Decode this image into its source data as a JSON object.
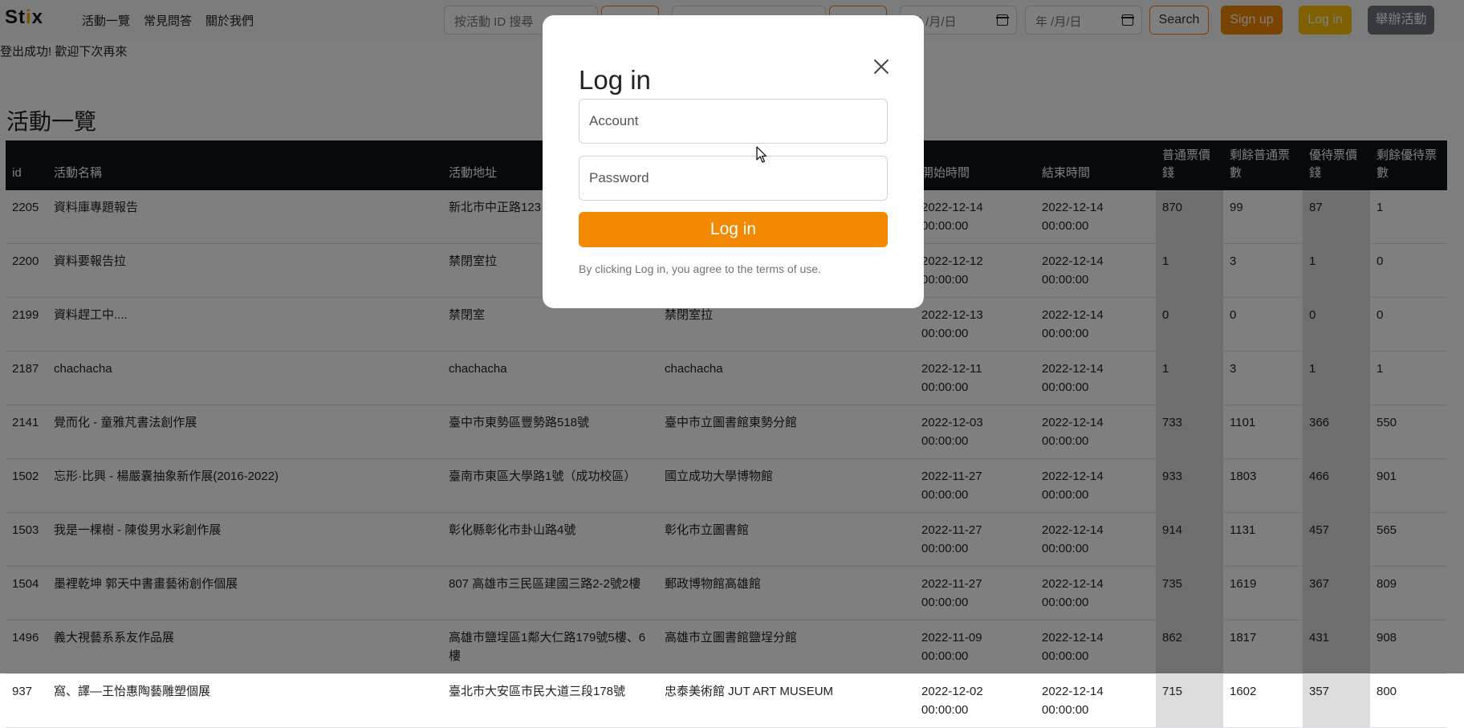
{
  "navbar": {
    "brand_prefix": "St",
    "brand_accent": "i",
    "brand_suffix": "x",
    "links": [
      "活動一覽",
      "常見問答",
      "關於我們"
    ],
    "search_id_placeholder": "按活動 ID 搜尋",
    "date_from_placeholder": "年 /月/日",
    "date_to_placeholder": "年 /月/日",
    "search_label": "Search",
    "signup_label": "Sign up",
    "login_label": "Log in",
    "host_label": "舉辦活動"
  },
  "flash_message": "登出成功! 歡迎下次再來",
  "page_title": "活動一覽",
  "table": {
    "columns": [
      "id",
      "活動名稱",
      "活動地址",
      "",
      "開始時間",
      "結束時間",
      "普通票價錢",
      "剩餘普通票數",
      "優待票價錢",
      "剩餘優待票數"
    ],
    "rows": [
      [
        "2205",
        "資料庫專題報告",
        "新北市中正路123",
        "",
        "2022-12-14 00:00:00",
        "2022-12-14 00:00:00",
        "870",
        "99",
        "87",
        "1"
      ],
      [
        "2200",
        "資料要報告拉",
        "禁閉室拉",
        "",
        "2022-12-12 00:00:00",
        "2022-12-14 00:00:00",
        "1",
        "3",
        "1",
        "0"
      ],
      [
        "2199",
        "資料趕工中....",
        "禁閉室",
        "禁閉室拉",
        "2022-12-13 00:00:00",
        "2022-12-14 00:00:00",
        "0",
        "0",
        "0",
        "0"
      ],
      [
        "2187",
        "chachacha",
        "chachacha",
        "chachacha",
        "2022-12-11 00:00:00",
        "2022-12-14 00:00:00",
        "1",
        "3",
        "1",
        "1"
      ],
      [
        "2141",
        "覺而化 - 童雅芃書法創作展",
        "臺中市東勢區豐勢路518號",
        "臺中市立圖書館東勢分館",
        "2022-12-03 00:00:00",
        "2022-12-14 00:00:00",
        "733",
        "1101",
        "366",
        "550"
      ],
      [
        "1502",
        "忘形·比興 - 楊嚴囊抽象新作展(2016-2022)",
        "臺南市東區大學路1號（成功校區）",
        "國立成功大學博物館",
        "2022-11-27 00:00:00",
        "2022-12-14 00:00:00",
        "933",
        "1803",
        "466",
        "901"
      ],
      [
        "1503",
        "我是一棵樹 - 陳俊男水彩創作展",
        "彰化縣彰化市卦山路4號",
        "彰化市立圖書館",
        "2022-11-27 00:00:00",
        "2022-12-14 00:00:00",
        "914",
        "1131",
        "457",
        "565"
      ],
      [
        "1504",
        "墨裡乾坤 郭天中書畫藝術創作個展",
        "807 高雄市三民區建國三路2-2號2樓",
        "郵政博物館高雄館",
        "2022-11-27 00:00:00",
        "2022-12-14 00:00:00",
        "735",
        "1619",
        "367",
        "809"
      ],
      [
        "1496",
        "義大視藝系系友作品展",
        "高雄市鹽埕區1鄰大仁路179號5樓、6樓",
        "高雄市立圖書館鹽埕分館",
        "2022-11-09 00:00:00",
        "2022-12-14 00:00:00",
        "862",
        "1817",
        "431",
        "908"
      ],
      [
        "937",
        "窩、譯—王怡惠陶藝雕塑個展",
        "臺北市大安區市民大道三段178號",
        "忠泰美術館 JUT ART MUSEUM",
        "2022-12-02 00:00:00",
        "2022-12-14 00:00:00",
        "715",
        "1602",
        "357",
        "800"
      ]
    ]
  },
  "modal": {
    "title": "Log in",
    "account_placeholder": "Account",
    "password_placeholder": "Password",
    "submit_label": "Log in",
    "terms_text": "By clicking Log in, you agree to the terms of use."
  },
  "colors": {
    "brand_accent": "#f0a000",
    "primary_orange": "#f38900",
    "warning_yellow": "#ffc107",
    "secondary_gray": "#6c757d",
    "table_header_bg": "#0f141a"
  }
}
